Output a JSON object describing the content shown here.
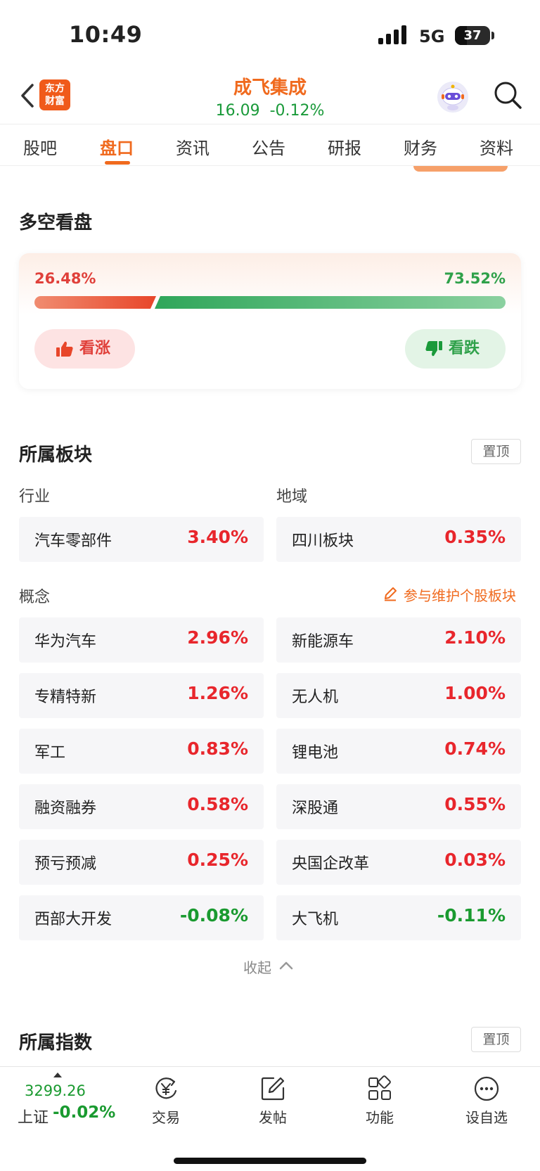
{
  "status_bar": {
    "time": "10:49",
    "network": "5G",
    "battery": "37"
  },
  "header": {
    "logo_line1": "东方",
    "logo_line2": "财富",
    "stock_name": "成飞集成",
    "stock_price": "16.09",
    "stock_change": "-0.12%"
  },
  "tabs": [
    {
      "label": "股吧",
      "active": false
    },
    {
      "label": "盘口",
      "active": true
    },
    {
      "label": "资讯",
      "active": false
    },
    {
      "label": "公告",
      "active": false
    },
    {
      "label": "研报",
      "active": false
    },
    {
      "label": "财务",
      "active": false
    },
    {
      "label": "资料",
      "active": false
    }
  ],
  "sentiment": {
    "title": "多空看盘",
    "bull_percent_label": "26.48%",
    "bear_percent_label": "73.52%",
    "bull_fraction": 0.2648,
    "bull_button": "看涨",
    "bear_button": "看跌"
  },
  "sectors": {
    "title": "所属板块",
    "pin_label": "置顶",
    "industry_label": "行业",
    "region_label": "地域",
    "industry": {
      "name": "汽车零部件",
      "pct": "3.40%"
    },
    "region": {
      "name": "四川板块",
      "pct": "0.35%"
    },
    "concept_label": "概念",
    "maintain_link": "参与维护个股板块",
    "concepts": [
      {
        "name": "华为汽车",
        "pct": "2.96%"
      },
      {
        "name": "新能源车",
        "pct": "2.10%"
      },
      {
        "name": "专精特新",
        "pct": "1.26%"
      },
      {
        "name": "无人机",
        "pct": "1.00%"
      },
      {
        "name": "军工",
        "pct": "0.83%"
      },
      {
        "name": "锂电池",
        "pct": "0.74%"
      },
      {
        "name": "融资融券",
        "pct": "0.58%"
      },
      {
        "name": "深股通",
        "pct": "0.55%"
      },
      {
        "name": "预亏预减",
        "pct": "0.25%"
      },
      {
        "name": "央国企改革",
        "pct": "0.03%"
      },
      {
        "name": "西部大开发",
        "pct": "-0.08%"
      },
      {
        "name": "大飞机",
        "pct": "-0.11%"
      }
    ],
    "collapse_label": "收起"
  },
  "indices": {
    "title": "所属指数",
    "pin_label": "置顶"
  },
  "bottom_bar": {
    "index_value": "3299.26",
    "index_name": "上证",
    "index_change": "-0.02%",
    "nav": [
      {
        "label": "交易",
        "icon": "yuan-exchange-icon"
      },
      {
        "label": "发帖",
        "icon": "compose-icon"
      },
      {
        "label": "功能",
        "icon": "grid-icon"
      },
      {
        "label": "设自选",
        "icon": "more-dots-icon"
      }
    ]
  },
  "colors": {
    "accent": "#f06a1e",
    "up": "#e8262c",
    "down": "#1a9a30"
  }
}
